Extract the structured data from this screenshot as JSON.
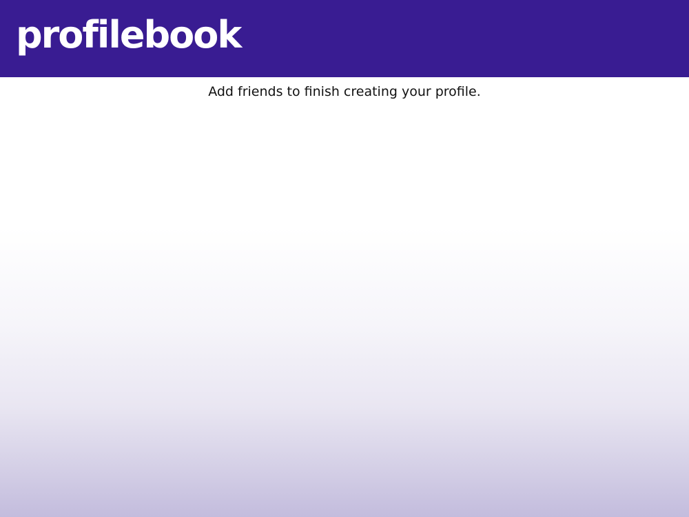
{
  "header": {
    "logo_text": "profilebook",
    "background_color": "#391c92",
    "text_color": "#ffffff"
  },
  "main": {
    "message": "Add friends to finish creating your profile.",
    "gradient_top_color": "#ffffff",
    "gradient_bottom_color": "#c3bcdd"
  }
}
